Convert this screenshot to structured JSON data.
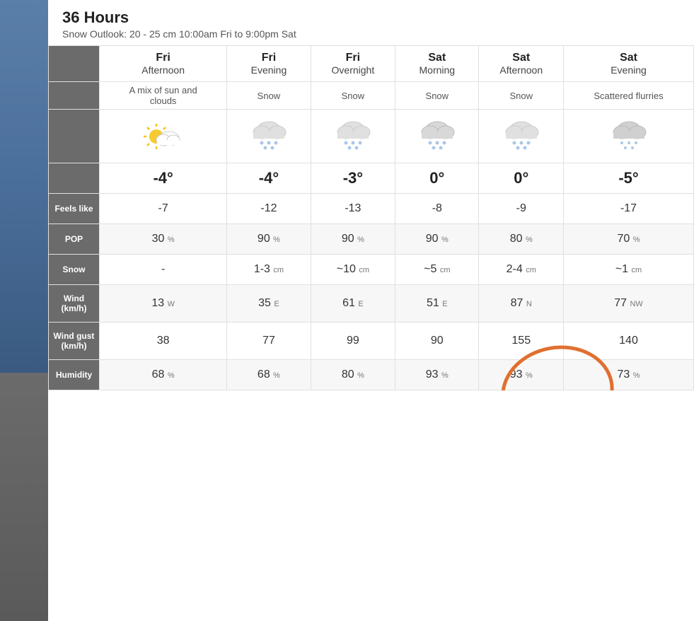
{
  "header": {
    "title": "36 Hours",
    "subtitle": "Snow Outlook: 20 - 25 cm    10:00am Fri to 9:00pm Sat"
  },
  "columns": [
    {
      "day": "Fri",
      "period": "Afternoon",
      "condition": "A mix of sun and clouds",
      "icon": "sun-cloud",
      "temp": "-4°",
      "feels_like": "-7",
      "pop": "30",
      "snow": "-",
      "wind": "13",
      "wind_dir": "W",
      "wind_gust": "38",
      "humidity": "68"
    },
    {
      "day": "Fri",
      "period": "Evening",
      "condition": "Snow",
      "icon": "snow",
      "temp": "-4°",
      "feels_like": "-12",
      "pop": "90",
      "snow": "1-3 cm",
      "wind": "35",
      "wind_dir": "E",
      "wind_gust": "77",
      "humidity": "68"
    },
    {
      "day": "Fri",
      "period": "Overnight",
      "condition": "Snow",
      "icon": "snow",
      "temp": "-3°",
      "feels_like": "-13",
      "pop": "90",
      "snow": "~10 cm",
      "wind": "61",
      "wind_dir": "E",
      "wind_gust": "99",
      "humidity": "80"
    },
    {
      "day": "Sat",
      "period": "Morning",
      "condition": "Snow",
      "icon": "snow-light",
      "temp": "0°",
      "feels_like": "-8",
      "pop": "90",
      "snow": "~5 cm",
      "wind": "51",
      "wind_dir": "E",
      "wind_gust": "90",
      "humidity": "93"
    },
    {
      "day": "Sat",
      "period": "Afternoon",
      "condition": "Snow",
      "icon": "snow",
      "temp": "0°",
      "feels_like": "-9",
      "pop": "80",
      "snow": "2-4 cm",
      "wind": "87",
      "wind_dir": "N",
      "wind_gust": "155",
      "humidity": "93"
    },
    {
      "day": "Sat",
      "period": "Evening",
      "condition": "Scattered flurries",
      "icon": "snow-light",
      "temp": "-5°",
      "feels_like": "-17",
      "pop": "70",
      "snow": "~1 cm",
      "wind": "77",
      "wind_dir": "NW",
      "wind_gust": "140",
      "humidity": "73"
    }
  ],
  "row_labels": {
    "feels_like": "Feels like",
    "pop": "POP",
    "snow": "Snow",
    "wind": "Wind\n(km/h)",
    "wind_gust": "Wind gust\n(km/h)",
    "humidity": "Humidity"
  },
  "circle": {
    "description": "Orange circle annotation around Sat Afternoon wind and gust values"
  }
}
